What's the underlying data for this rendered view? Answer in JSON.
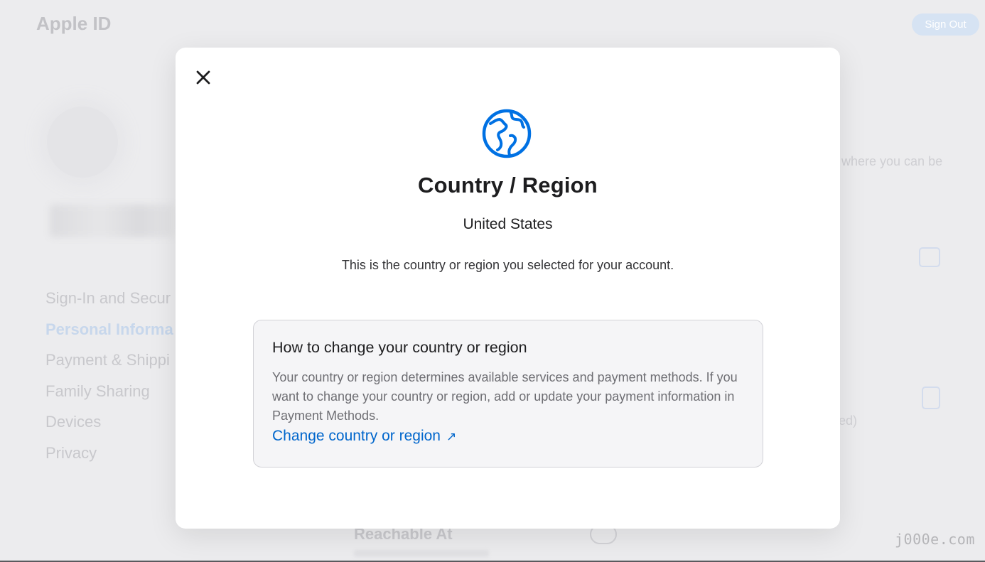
{
  "background": {
    "app_title": "Apple ID",
    "sign_out_label": "Sign Out",
    "nav_items": [
      {
        "label": "Sign-In and Secur",
        "active": false
      },
      {
        "label": "Personal Informa",
        "active": true
      },
      {
        "label": "Payment & Shippi",
        "active": false
      },
      {
        "label": "Family Sharing",
        "active": false
      },
      {
        "label": "Devices",
        "active": false
      },
      {
        "label": "Privacy",
        "active": false
      }
    ],
    "right_text_top": "where you can be",
    "right_text_mid": "ed)",
    "reachable_title": "Reachable At"
  },
  "modal": {
    "icon": "globe-icon",
    "title": "Country / Region",
    "value": "United States",
    "description": "This is the country or region you selected for your account.",
    "info": {
      "heading": "How to change your country or region",
      "body": "Your country or region determines available services and payment methods. If you want to change your country or region, add or update your payment information in Payment Methods.",
      "link_label": "Change country or region",
      "link_icon": "external-arrow-icon"
    }
  },
  "watermark": "j000e.com",
  "colors": {
    "accent": "#0066cc",
    "globe": "#0071e3",
    "info_box_bg": "#f5f5f7"
  }
}
